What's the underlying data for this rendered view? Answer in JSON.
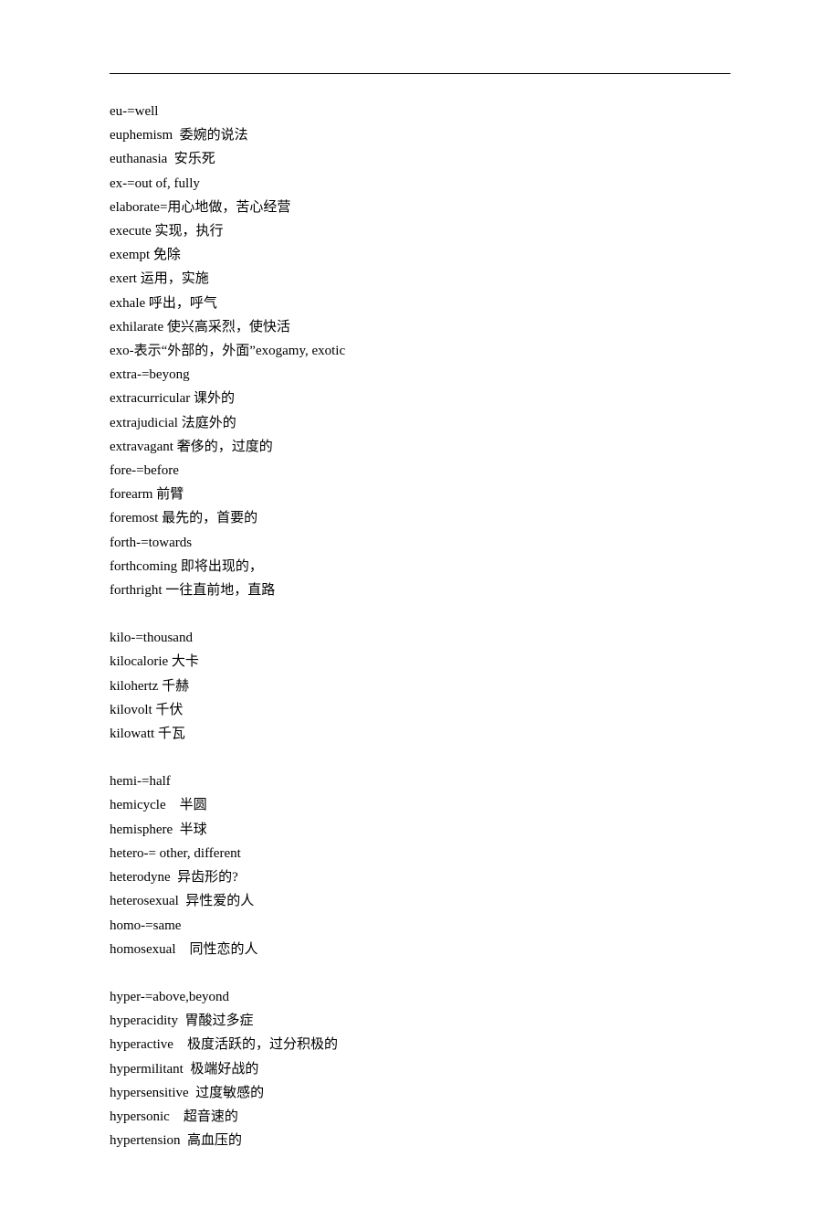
{
  "groups": [
    {
      "lines": [
        "eu-=well",
        "euphemism  委婉的说法",
        "euthanasia  安乐死",
        "ex-=out of, fully",
        "elaborate=用心地做，苦心经营",
        "execute 实现，执行",
        "exempt 免除",
        "exert 运用，实施",
        "exhale 呼出，呼气",
        "exhilarate 使兴高采烈，使快活",
        "exo-表示“外部的，外面”exogamy, exotic",
        "extra-=beyong",
        "extracurricular 课外的",
        "extrajudicial 法庭外的",
        "extravagant 奢侈的，过度的",
        "fore-=before",
        "forearm 前臂",
        "foremost 最先的，首要的",
        "forth-=towards",
        "forthcoming 即将出现的，",
        "forthright 一往直前地，直路"
      ]
    },
    {
      "lines": [
        "kilo-=thousand",
        "kilocalorie 大卡",
        "kilohertz 千赫",
        "kilovolt 千伏",
        "kilowatt 千瓦"
      ]
    },
    {
      "lines": [
        "hemi-=half",
        "hemicycle    半圆",
        "hemisphere  半球",
        "hetero-= other, different",
        "heterodyne  异齿形的?",
        "heterosexual  异性爱的人",
        "homo-=same",
        "homosexual    同性恋的人"
      ]
    },
    {
      "lines": [
        "hyper-=above,beyond",
        "hyperacidity  胃酸过多症",
        "hyperactive    极度活跃的，过分积极的",
        "hypermilitant  极端好战的",
        "hypersensitive  过度敏感的",
        "hypersonic    超音速的",
        "hypertension  高血压的"
      ]
    }
  ]
}
